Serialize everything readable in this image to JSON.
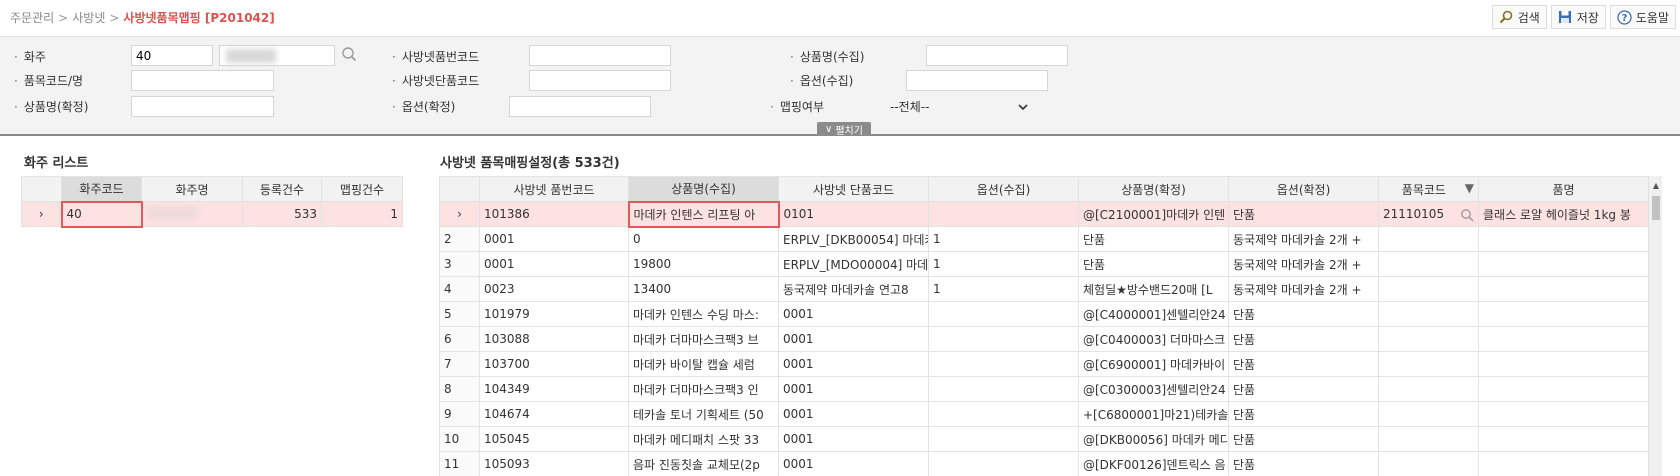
{
  "breadcrumb": {
    "items": [
      "주문관리",
      "사방넷"
    ],
    "current": "사방넷품목맵핑 [P201042]",
    "separator": ">"
  },
  "toolbar": {
    "search_label": "검색",
    "save_label": "저장",
    "help_label": "도움말"
  },
  "filters": {
    "owner_label": "화주",
    "owner_code": "40",
    "item_code_label": "품목코드/명",
    "item_code_value": "",
    "product_name_confirmed_label": "상품명(확정)",
    "product_name_confirmed_value": "",
    "sabangnet_item_no_label": "사방넷품번코드",
    "sabangnet_item_no_value": "",
    "sabangnet_single_code_label": "사방넷단품코드",
    "sabangnet_single_code_value": "",
    "option_confirmed_label": "옵션(확정)",
    "option_confirmed_value": "",
    "product_name_collected_label": "상품명(수집)",
    "product_name_collected_value": "",
    "option_collected_label": "옵션(수집)",
    "option_collected_value": "",
    "mapping_label": "맵핑여부",
    "mapping_value": "--전체--",
    "fold_label": "펼치기"
  },
  "owner_list": {
    "title": "화주 리스트",
    "headers": [
      "화주코드",
      "화주명",
      "등록건수",
      "맵핑건수"
    ],
    "rows": [
      {
        "code": "40",
        "name": "",
        "registered": "533",
        "mapped": "1"
      }
    ]
  },
  "mapping_grid": {
    "title": "사방넷 품목매핑설정(총 533건)",
    "headers": [
      "사방넷 품번코드",
      "상품명(수집)",
      "사방넷 단품코드",
      "옵션(수집)",
      "상품명(확정)",
      "옵션(확정)",
      "품목코드",
      "품명"
    ],
    "rows": [
      {
        "no": "",
        "item_no": "101386",
        "name_col": "마데카 인텐스 리프팅 아",
        "single": "0101",
        "opt_col": "",
        "name_conf": "@[C2100001]마데카 인텐",
        "opt_conf": "단품",
        "item_code": "21110105",
        "item_name": "클래스 로얄 헤이즐넛 1kg 봉"
      },
      {
        "no": "2",
        "item_no": "0001",
        "name_col": "0",
        "single": "ERPLV_[DKB00054] 마데카",
        "opt_col": "1",
        "name_conf": "단품",
        "opt_conf": "동국제약 마데카솔 2개 +",
        "item_code": "",
        "item_name": ""
      },
      {
        "no": "3",
        "item_no": "0001",
        "name_col": "19800",
        "single": "ERPLV_[MDO00004] 마데카",
        "opt_col": "1",
        "name_conf": "단품",
        "opt_conf": "동국제약 마데카솔 2개 +",
        "item_code": "",
        "item_name": ""
      },
      {
        "no": "4",
        "item_no": "0023",
        "name_col": "13400",
        "single": "동국제약 마데카솔 연고8",
        "opt_col": "1",
        "name_conf": "체험딜★방수밴드20매 [L",
        "opt_conf": "동국제약 마데카솔 2개 +",
        "item_code": "",
        "item_name": ""
      },
      {
        "no": "5",
        "item_no": "101979",
        "name_col": "마데카 인텐스 수딩 마스:",
        "single": "0001",
        "opt_col": "",
        "name_conf": "@[C4000001]센텔리안24",
        "opt_conf": "단품",
        "item_code": "",
        "item_name": ""
      },
      {
        "no": "6",
        "item_no": "103088",
        "name_col": "마데카 더마마스크팩3 브",
        "single": "0001",
        "opt_col": "",
        "name_conf": "@[C0400003] 더마마스크",
        "opt_conf": "단품",
        "item_code": "",
        "item_name": ""
      },
      {
        "no": "7",
        "item_no": "103700",
        "name_col": "마데카 바이탈 캡슐 세럼",
        "single": "0001",
        "opt_col": "",
        "name_conf": "@[C6900001] 마데카바이",
        "opt_conf": "단품",
        "item_code": "",
        "item_name": ""
      },
      {
        "no": "8",
        "item_no": "104349",
        "name_col": "마데카 더마마스크팩3 인",
        "single": "0001",
        "opt_col": "",
        "name_conf": "@[C0300003]센텔리안24",
        "opt_conf": "단품",
        "item_code": "",
        "item_name": ""
      },
      {
        "no": "9",
        "item_no": "104674",
        "name_col": "테카솔 토너 기획세트 (50",
        "single": "0001",
        "opt_col": "",
        "name_conf": "+[C6800001]마21)테카솔",
        "opt_conf": "단품",
        "item_code": "",
        "item_name": ""
      },
      {
        "no": "10",
        "item_no": "105045",
        "name_col": "마데카 메디패치 스팟 33",
        "single": "0001",
        "opt_col": "",
        "name_conf": "@[DKB00056] 마데카 메디",
        "opt_conf": "단품",
        "item_code": "",
        "item_name": ""
      },
      {
        "no": "11",
        "item_no": "105093",
        "name_col": "음파 진동칫솔 교체모(2p",
        "single": "0001",
        "opt_col": "",
        "name_conf": "@[DKF00126]덴트릭스 음",
        "opt_conf": "단품",
        "item_code": "",
        "item_name": ""
      }
    ]
  },
  "colors": {
    "accent": "#d9534f",
    "selected_row": "#fde2e2",
    "header_bg": "#f2f2f2"
  }
}
